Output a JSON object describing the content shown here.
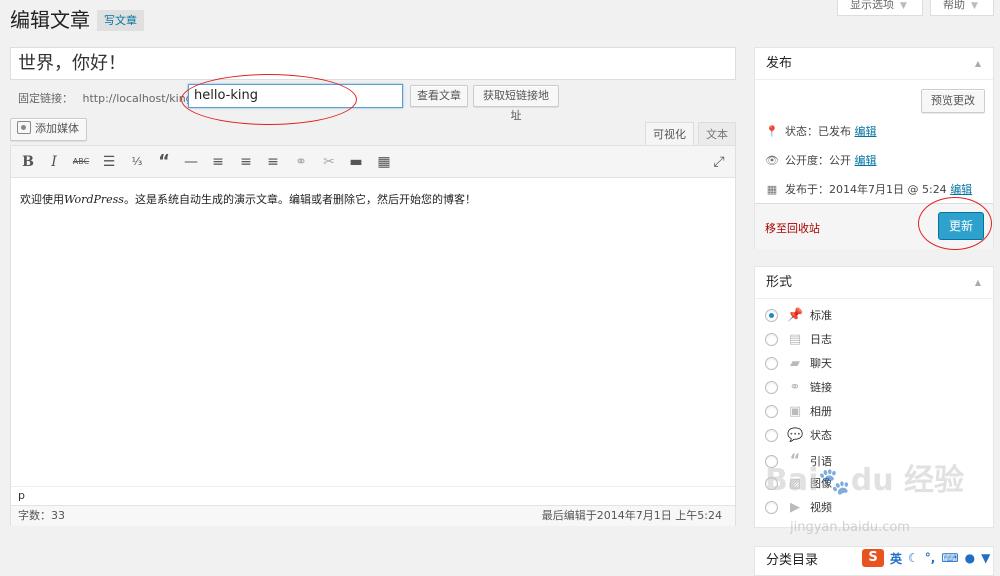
{
  "screen_options": {
    "label": "显示选项"
  },
  "help": {
    "label": "帮助"
  },
  "header": {
    "title": "编辑文章",
    "add_new": "写文章"
  },
  "post": {
    "title": "世界，你好！",
    "permalink_label": "固定链接：",
    "permalink_base": "http://localhost/king",
    "slug": "hello-king",
    "view_post": "查看文章",
    "get_shortlink": "获取短链接地址"
  },
  "editor": {
    "add_media": "添加媒体",
    "tab_visual": "可视化",
    "tab_text": "文本",
    "content_prefix": "欢迎使用",
    "content_italic": "WordPress",
    "content_suffix": "。这是系统自动生成的演示文章。编辑或者删除它，然后开始您的博客！",
    "path": "p",
    "word_count": "字数：33",
    "last_edited": "最后编辑于2014年7月1日 上午5:24"
  },
  "publish": {
    "title": "发布",
    "preview": "预览更改",
    "status_label": "状态：",
    "status_value": "已发布",
    "visibility_label": "公开度：",
    "visibility_value": "公开",
    "published_label": "发布于：",
    "published_value": "2014年7月1日 @ 5:24",
    "edit": "编辑",
    "trash": "移至回收站",
    "update": "更新"
  },
  "format": {
    "title": "形式",
    "options": [
      {
        "label": "标准",
        "icon": "pin-icon",
        "checked": true
      },
      {
        "label": "日志",
        "icon": "aside-icon",
        "checked": false
      },
      {
        "label": "聊天",
        "icon": "chat-icon",
        "checked": false
      },
      {
        "label": "链接",
        "icon": "link-icon",
        "checked": false
      },
      {
        "label": "相册",
        "icon": "gallery-icon",
        "checked": false
      },
      {
        "label": "状态",
        "icon": "status-icon",
        "checked": false
      },
      {
        "label": "引语",
        "icon": "quote-icon",
        "checked": false
      },
      {
        "label": "图像",
        "icon": "image-icon",
        "checked": false
      },
      {
        "label": "视频",
        "icon": "video-icon",
        "checked": false
      }
    ]
  },
  "categories": {
    "title": "分类目录"
  },
  "watermark": {
    "url": "jingyan.baidu.com"
  },
  "ime": {
    "lang": "英"
  },
  "colors": {
    "accent": "#2ea2cc",
    "link": "#0074a2",
    "trash": "#aa0000",
    "annotation": "#e02020"
  }
}
